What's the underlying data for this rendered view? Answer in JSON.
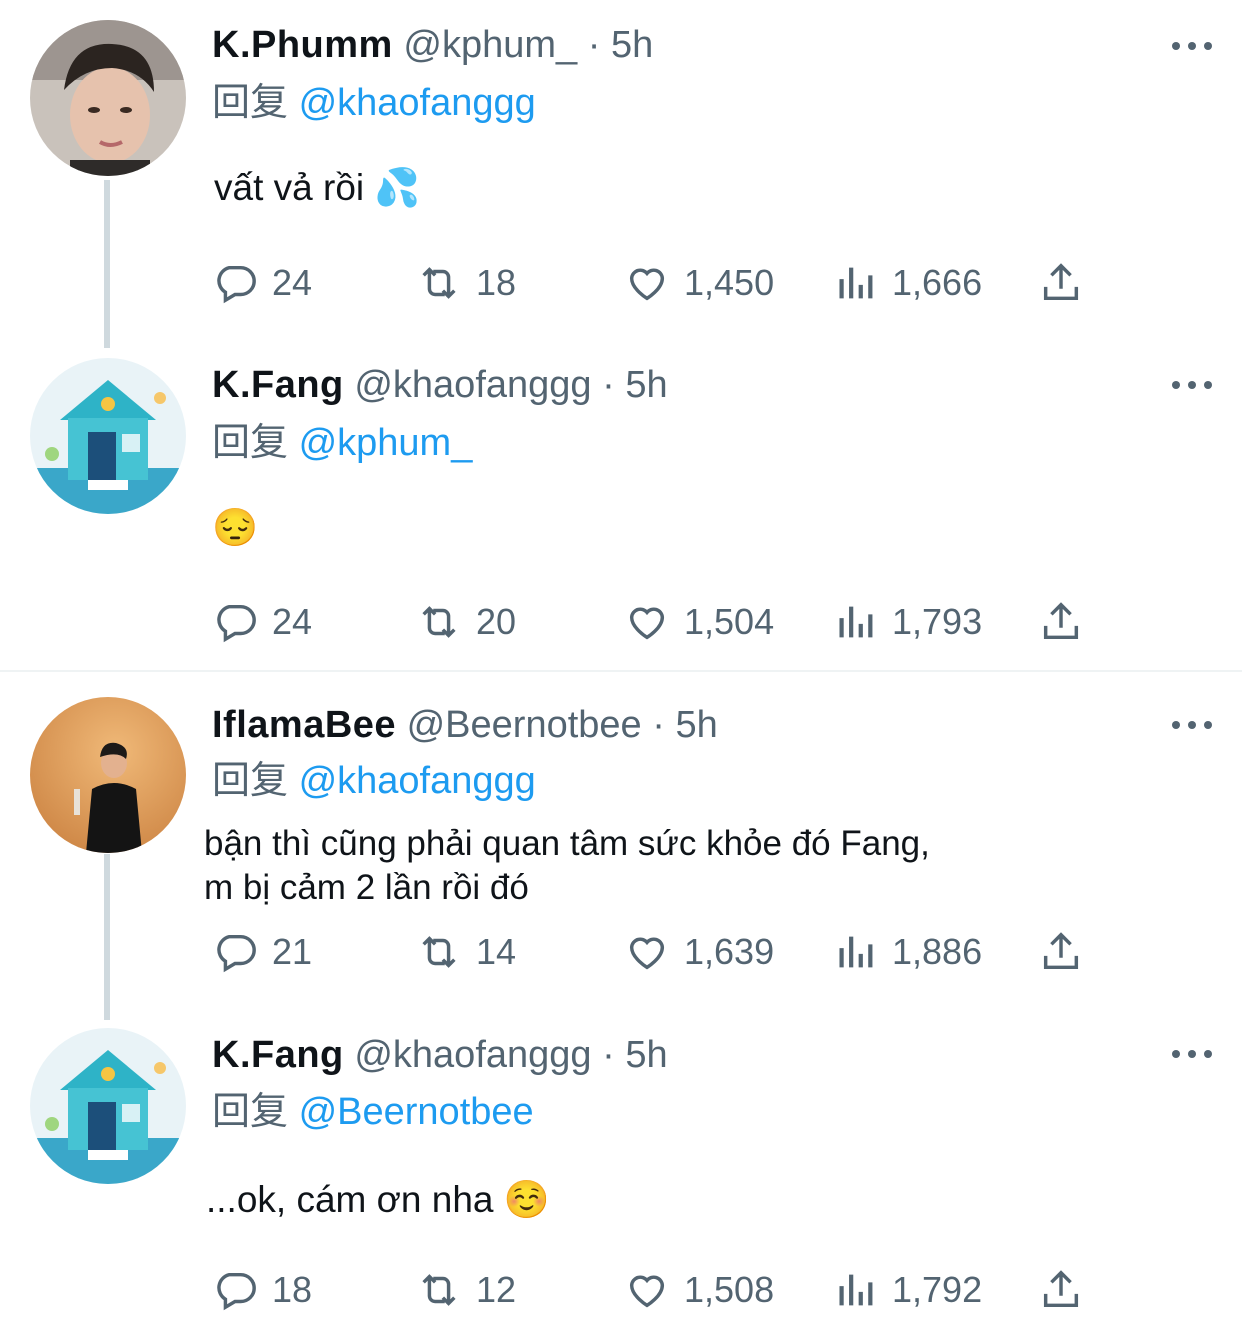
{
  "tweets": [
    {
      "name": "K.Phumm",
      "handle": "@kphum_",
      "time": "5h",
      "reply_prefix": "回复",
      "reply_to": "@khaofanggg",
      "text": "vất vả rồi 💦",
      "replies": "24",
      "retweets": "18",
      "likes": "1,450",
      "views": "1,666"
    },
    {
      "name": "K.Fang",
      "handle": "@khaofanggg",
      "time": "5h",
      "reply_prefix": "回复",
      "reply_to": "@kphum_",
      "text": "😔",
      "replies": "24",
      "retweets": "20",
      "likes": "1,504",
      "views": "1,793"
    },
    {
      "name": "IflamaBee",
      "handle": "@Beernotbee",
      "time": "5h",
      "reply_prefix": "回复",
      "reply_to": "@khaofanggg",
      "text_line1": "bận thì cũng phải quan tâm sức khỏe đó Fang,",
      "text_line2": "m bị cảm 2 lần rồi đó",
      "replies": "21",
      "retweets": "14",
      "likes": "1,639",
      "views": "1,886"
    },
    {
      "name": "K.Fang",
      "handle": "@khaofanggg",
      "time": "5h",
      "reply_prefix": "回复",
      "reply_to": "@Beernotbee",
      "text": "...ok, cám ơn nha ☺️",
      "replies": "18",
      "retweets": "12",
      "likes": "1,508",
      "views": "1,792"
    }
  ],
  "separator": " · ",
  "icons": [
    "reply-icon",
    "retweet-icon",
    "like-icon",
    "views-icon",
    "share-icon",
    "more-icon"
  ],
  "colors": {
    "text": "#0f1419",
    "secondary": "#536471",
    "link": "#1d9bf0",
    "thread_line": "#cfd9de"
  }
}
